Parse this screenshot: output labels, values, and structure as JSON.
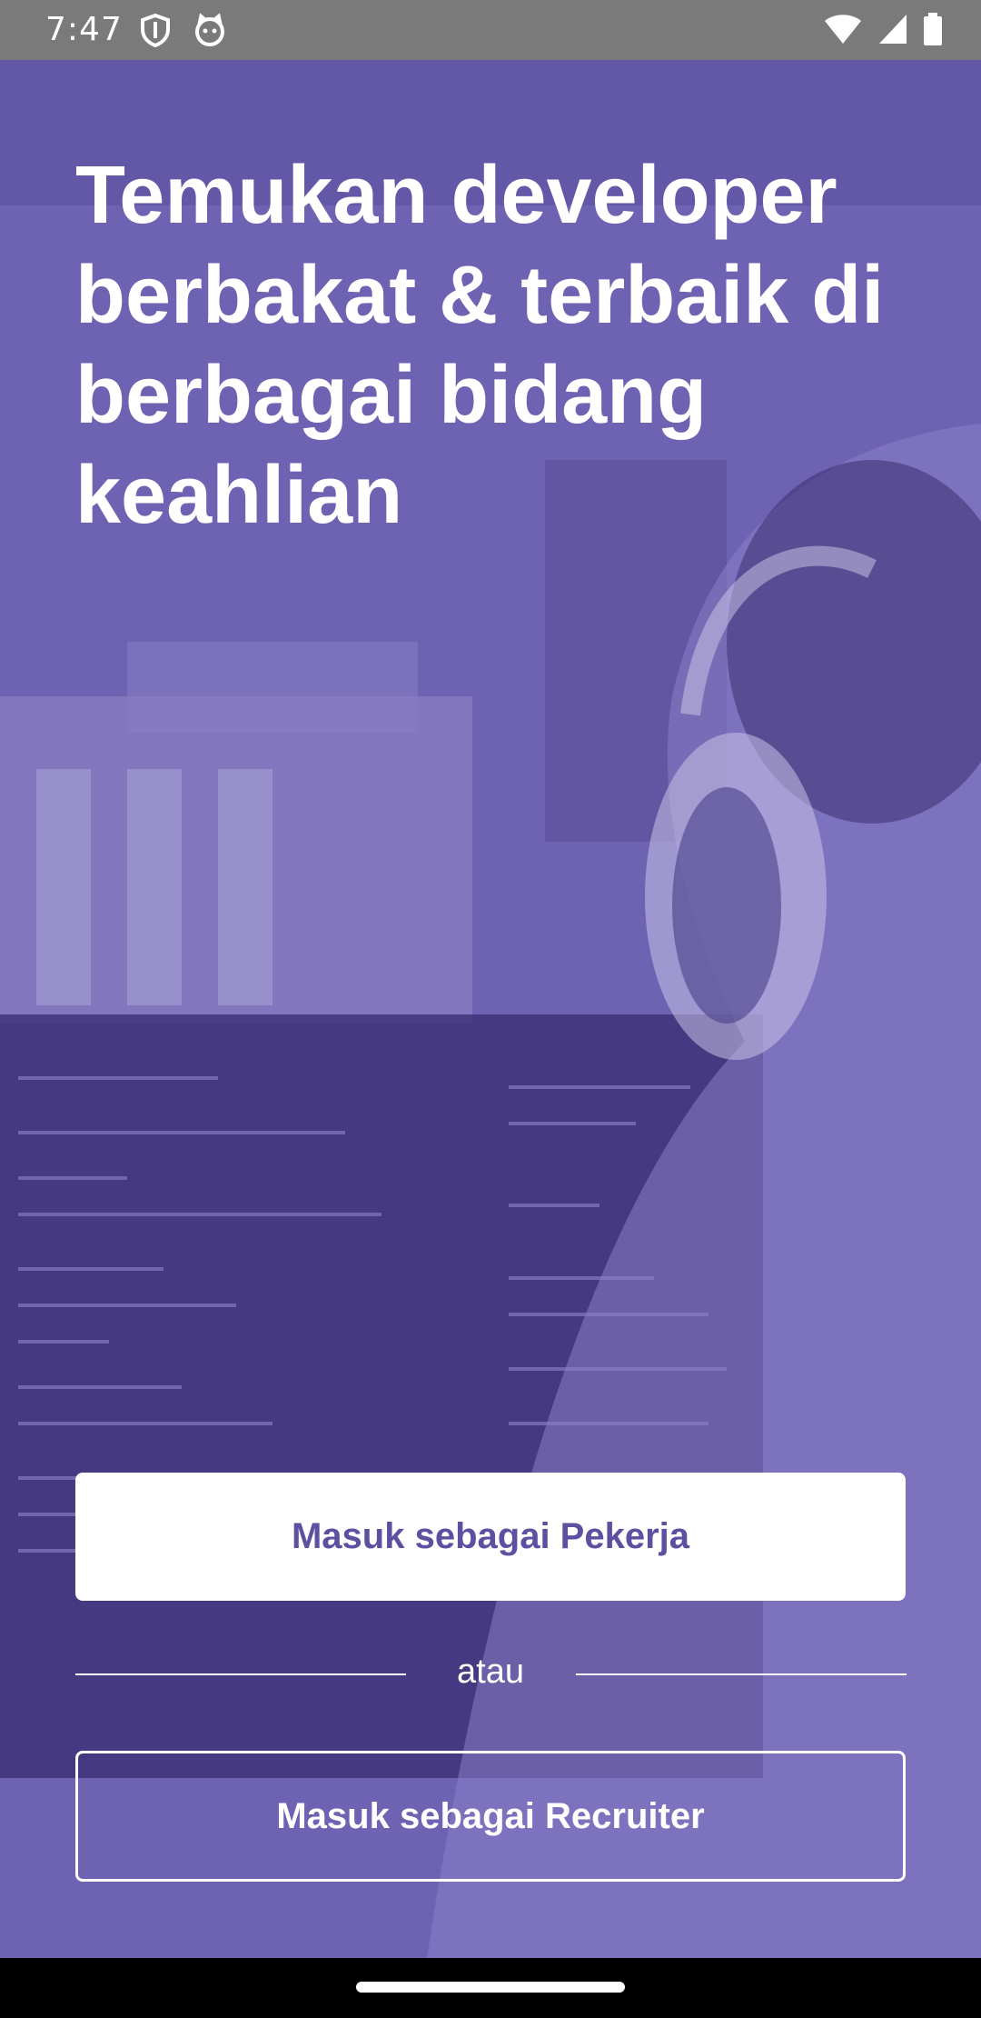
{
  "status_bar": {
    "time": "7:47",
    "left_icons": [
      "shield-icon",
      "cat-face-icon"
    ],
    "right_icons": [
      "wifi-icon",
      "signal-icon",
      "battery-icon"
    ]
  },
  "hero": {
    "headline": "Temukan developer berbakat & terbaik di berbagai bidang keahlian"
  },
  "actions": {
    "worker_login_label": "Masuk sebagai Pekerja",
    "divider_text": "atau",
    "recruiter_login_label": "Masuk sebagai Recruiter"
  },
  "colors": {
    "overlay_purple": "#6f63b4",
    "primary_text": "#5e50a1",
    "white": "#ffffff"
  }
}
